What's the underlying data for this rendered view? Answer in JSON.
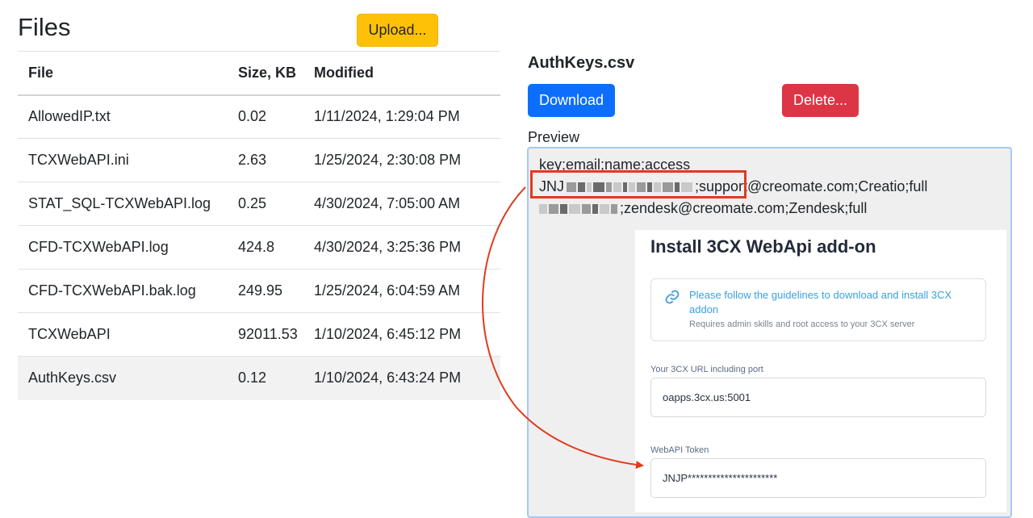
{
  "left": {
    "title": "Files",
    "upload_label": "Upload...",
    "table": {
      "headers": [
        "File",
        "Size, KB",
        "Modified"
      ],
      "rows": [
        {
          "file": "AllowedIP.txt",
          "size": "0.02",
          "modified": "1/11/2024, 1:29:04 PM"
        },
        {
          "file": "TCXWebAPI.ini",
          "size": "2.63",
          "modified": "1/25/2024, 2:30:08 PM"
        },
        {
          "file": "STAT_SQL-TCXWebAPI.log",
          "size": "0.25",
          "modified": "4/30/2024, 7:05:00 AM"
        },
        {
          "file": "CFD-TCXWebAPI.log",
          "size": "424.8",
          "modified": "4/30/2024, 3:25:36 PM"
        },
        {
          "file": "CFD-TCXWebAPI.bak.log",
          "size": "249.95",
          "modified": "1/25/2024, 6:04:59 AM"
        },
        {
          "file": "TCXWebAPI",
          "size": "92011.53",
          "modified": "1/10/2024, 6:45:12 PM"
        },
        {
          "file": "AuthKeys.csv",
          "size": "0.12",
          "modified": "1/10/2024, 6:43:24 PM"
        }
      ]
    }
  },
  "right": {
    "file_name": "AuthKeys.csv",
    "download_label": "Download",
    "delete_label": "Delete...",
    "preview_label": "Preview",
    "preview": {
      "line1": "key;email;name;access",
      "line2_prefix": "JNJ",
      "line2_suffix": ";support@creomate.com;Creatio;full",
      "line3_suffix": ";zendesk@creomate.com;Zendesk;full"
    }
  },
  "addon": {
    "title": "Install 3CX WebApi add-on",
    "info_text": "Please follow the guidelines to download and install 3CX addon",
    "info_subtext": "Requires admin skills and root access to your 3CX server",
    "url_label": "Your 3CX URL including port",
    "url_value": "oapps.3cx.us:5001",
    "token_label": "WebAPI Token",
    "token_value": "JNJP**********************"
  },
  "colors": {
    "upload": "#ffc107",
    "download": "#0d6efd",
    "delete": "#dc3545",
    "annotation": "#e03a1e",
    "addon_link": "#3aa0e0"
  },
  "icons": [
    "link-icon"
  ]
}
